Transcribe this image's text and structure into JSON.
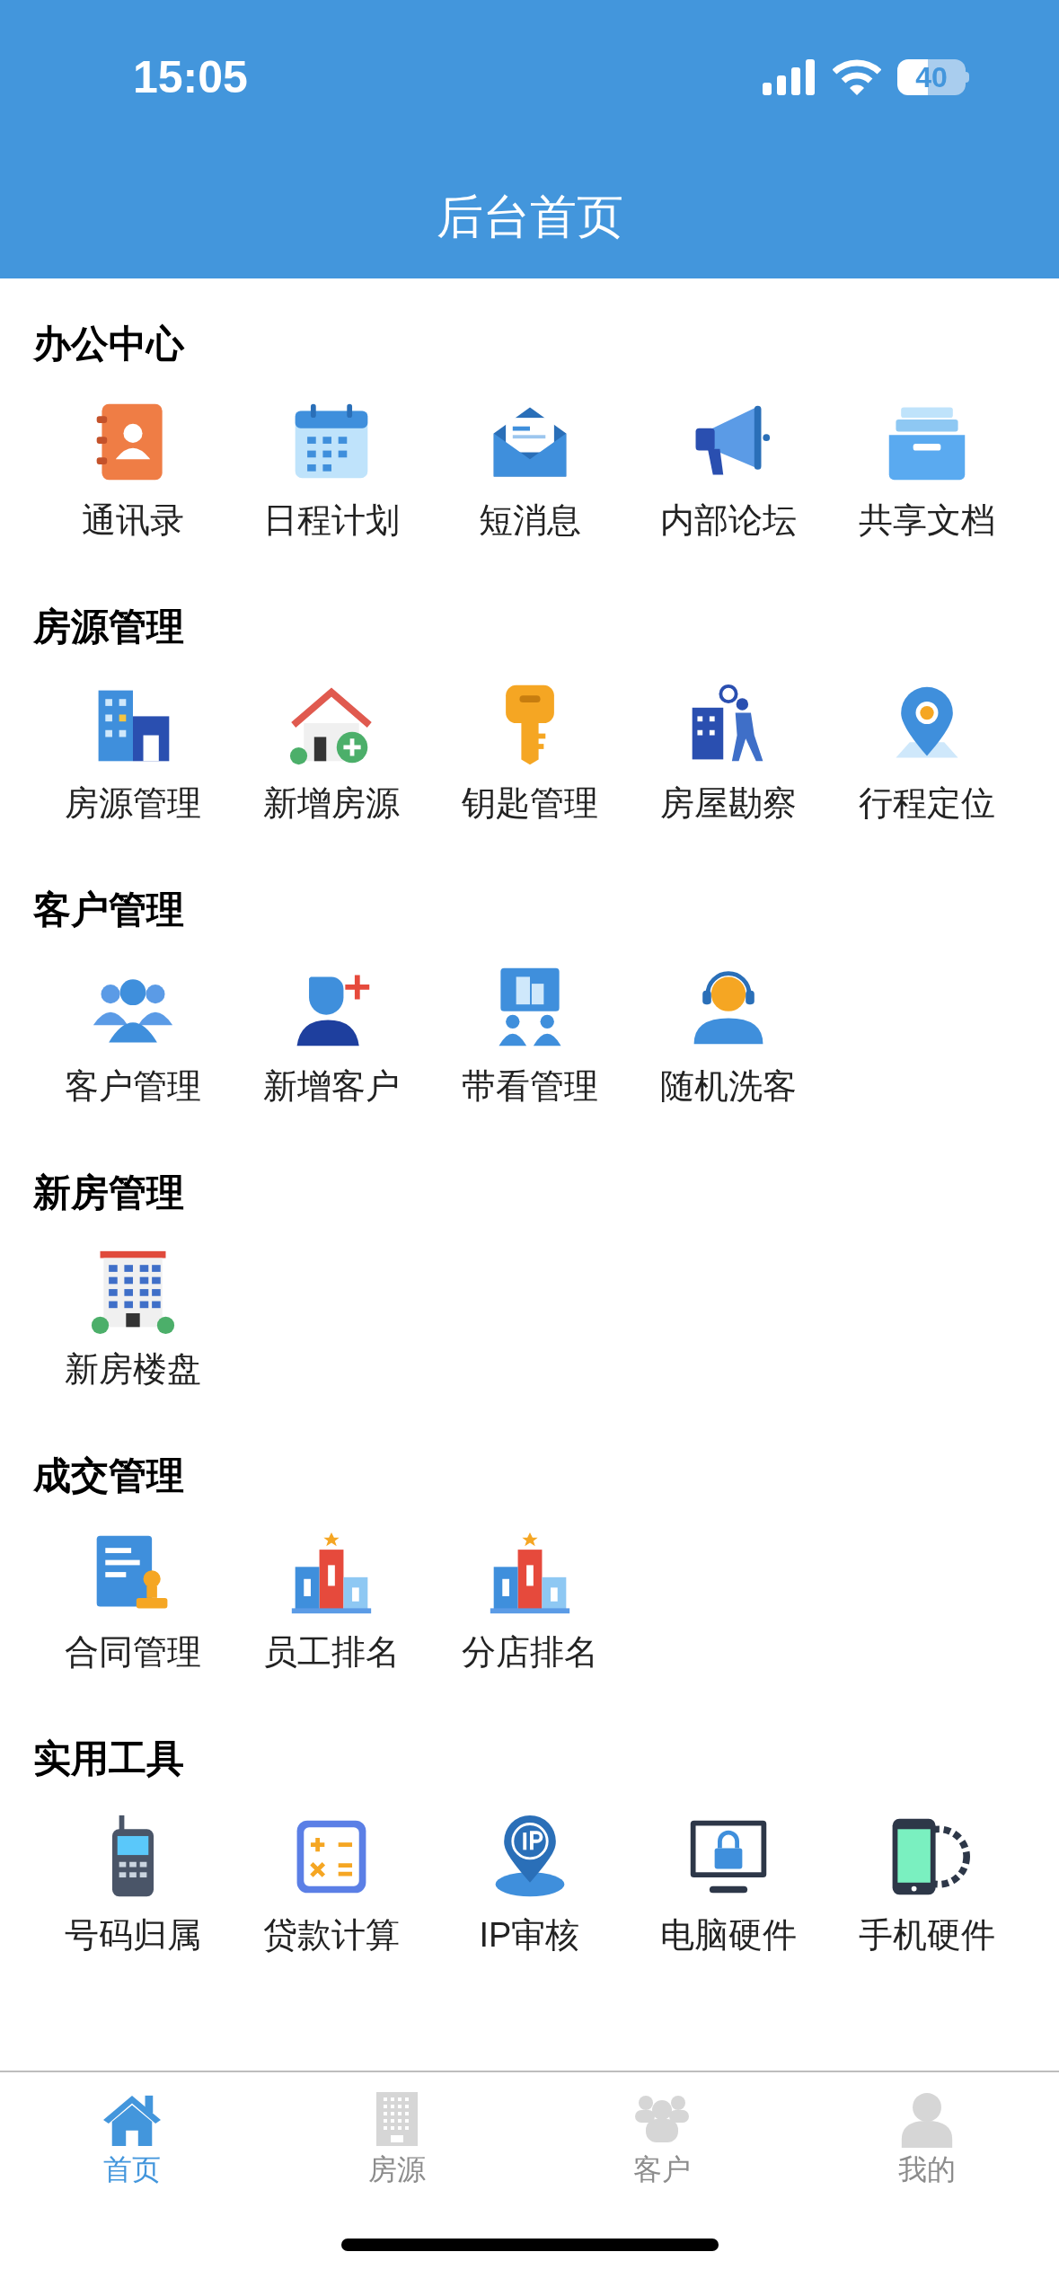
{
  "status_bar": {
    "time": "15:05",
    "battery": "40"
  },
  "header": {
    "title": "后台首页"
  },
  "sections": [
    {
      "title": "办公中心",
      "items": [
        {
          "label": "通讯录"
        },
        {
          "label": "日程计划"
        },
        {
          "label": "短消息"
        },
        {
          "label": "内部论坛"
        },
        {
          "label": "共享文档"
        }
      ]
    },
    {
      "title": "房源管理",
      "items": [
        {
          "label": "房源管理"
        },
        {
          "label": "新增房源"
        },
        {
          "label": "钥匙管理"
        },
        {
          "label": "房屋勘察"
        },
        {
          "label": "行程定位"
        }
      ]
    },
    {
      "title": "客户管理",
      "items": [
        {
          "label": "客户管理"
        },
        {
          "label": "新增客户"
        },
        {
          "label": "带看管理"
        },
        {
          "label": "随机洗客"
        }
      ]
    },
    {
      "title": "新房管理",
      "items": [
        {
          "label": "新房楼盘"
        }
      ]
    },
    {
      "title": "成交管理",
      "items": [
        {
          "label": "合同管理"
        },
        {
          "label": "员工排名"
        },
        {
          "label": "分店排名"
        }
      ]
    },
    {
      "title": "实用工具",
      "items": [
        {
          "label": "号码归属"
        },
        {
          "label": "贷款计算"
        },
        {
          "label": "IP审核"
        },
        {
          "label": "电脑硬件"
        },
        {
          "label": "手机硬件"
        }
      ]
    }
  ],
  "tab_bar": [
    {
      "label": "首页",
      "selected": true
    },
    {
      "label": "房源",
      "selected": false
    },
    {
      "label": "客户",
      "selected": false
    },
    {
      "label": "我的",
      "selected": false
    }
  ]
}
